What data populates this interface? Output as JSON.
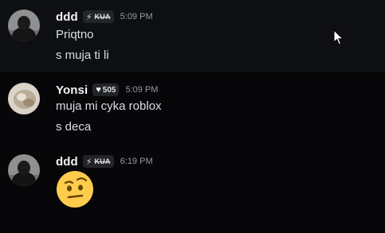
{
  "messages": [
    {
      "username": "ddd",
      "tag": {
        "icon": "bolt-icon",
        "text": "KUA"
      },
      "timestamp": "5:09 PM",
      "lines": [
        "Priqtno",
        "s muja ti li"
      ]
    },
    {
      "username": "Yonsi",
      "tag": {
        "icon": "heart-icon",
        "text": "505"
      },
      "timestamp": "5:09 PM",
      "lines": [
        "muja mi cyka roblox",
        "s deca"
      ]
    },
    {
      "username": "ddd",
      "tag": {
        "icon": "bolt-icon",
        "text": "KUA"
      },
      "timestamp": "6:19 PM",
      "emoji": "face-with-raised-eyebrow-emoji"
    }
  ],
  "colors": {
    "background": "#070709",
    "hover_background": "#0e0f12",
    "username": "#f2f3f5",
    "text": "#dbdee1",
    "timestamp": "#949ba4",
    "tag_background": "#232428"
  }
}
